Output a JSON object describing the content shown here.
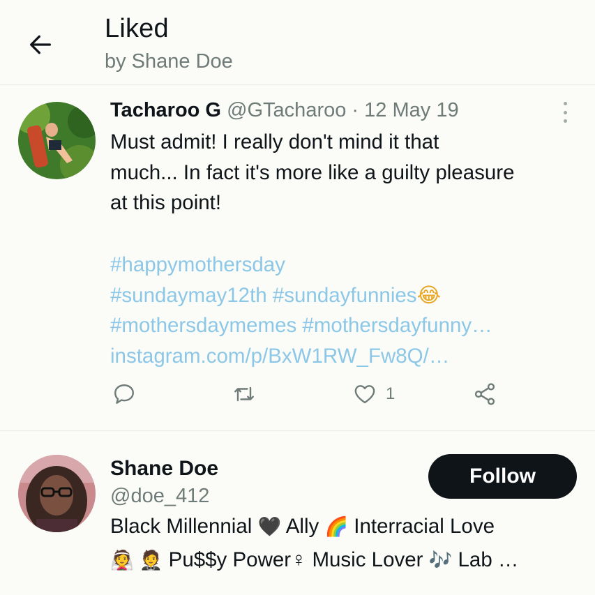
{
  "colors": {
    "background": "#fbfcf8",
    "text": "#0f1419",
    "secondary_text": "#6f7b78",
    "link": "#8cc7e7",
    "button_bg": "#0f1419",
    "button_text": "#ffffff",
    "divider": "#e9ebe6"
  },
  "header": {
    "back_icon": "arrow-left-icon",
    "title": "Liked",
    "subtitle": "by Shane Doe"
  },
  "tweet": {
    "author_name": "Tacharoo G",
    "author_handle": "@GTacharoo",
    "separator": "·",
    "date": "12 May 19",
    "more_icon": "more-vertical-icon",
    "text_lines": [
      "Must admit! I really don't mind it that",
      "much... In fact it's more like a guilty pleasure",
      "at this point!"
    ],
    "hashtag_line_1": "#happymothersday",
    "hashtag_line_2": "#sundaymay12th #sundayfunnies",
    "hashtag_line_2_emoji": "😂",
    "hashtag_line_3": "#mothersdaymemes #mothersdayfunny…",
    "link": "instagram.com/p/BxW1RW_Fw8Q/…",
    "actions": {
      "reply_icon": "reply-icon",
      "retweet_icon": "retweet-icon",
      "like_icon": "heart-icon",
      "like_count": "1",
      "share_icon": "share-icon"
    }
  },
  "profile": {
    "name": "Shane Doe",
    "handle": "@doe_412",
    "follow_label": "Follow",
    "bio_line_1": {
      "part1": "Black Millennial",
      "emoji1": "🖤",
      "part2": "Ally",
      "emoji2": "🌈",
      "part3": "Interracial Love"
    },
    "bio_line_2": {
      "emoji1": "👰",
      "emoji2": "🤵",
      "part1": "Pu$$y Power♀",
      "part2": "Music Lover",
      "emoji3": "🎶",
      "part3": "Lab …"
    }
  }
}
